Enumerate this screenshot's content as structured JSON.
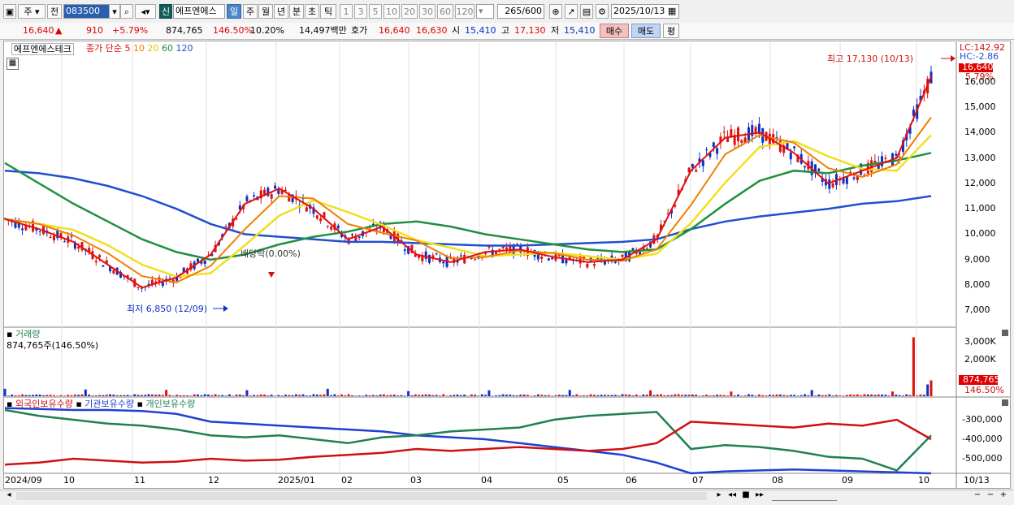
{
  "toolbar": {
    "period_label": "주",
    "prev_label": "전",
    "code_value": "083500",
    "new_badge": "신",
    "stock_name": "에프엔에스",
    "periods": [
      "일",
      "주",
      "월",
      "년",
      "분",
      "초",
      "틱"
    ],
    "active_period": "일",
    "intervals": [
      "1",
      "3",
      "5",
      "10",
      "20",
      "30",
      "60",
      "120"
    ],
    "count_value": "265",
    "count_total": "/600",
    "date_value": "2025/10/13"
  },
  "quote": {
    "price": "16,640",
    "up_arrow": "▲",
    "change": "910",
    "change_pct": "+5.79%",
    "volume": "874,765",
    "volume_ratio": "146.50%",
    "turnover_pct": "10.20%",
    "amount": "14,497백만",
    "hoga_label": "호가",
    "ask": "16,640",
    "bid": "16,630",
    "open_label": "시",
    "open": "15,410",
    "high_label": "고",
    "high": "17,130",
    "low_label": "저",
    "low": "15,410",
    "buy_label": "매수",
    "sell_label": "매도",
    "eval_label": "평"
  },
  "price_panel": {
    "name_tag": "에프엔에스테크",
    "ma_label": "종가 단순",
    "ma_periods": [
      "5",
      "10",
      "20",
      "60",
      "120"
    ],
    "ma_colors": [
      "#e01010",
      "#f08000",
      "#f0e020",
      "#209040",
      "#2050d0"
    ],
    "lc_label": "LC:142.92",
    "hc_label": "HC:-2.86",
    "current_price_tag": "16,640",
    "current_pct_tag": "5.79%",
    "high_annotation": "최고 17,130 (10/13)",
    "low_annotation": "최저 6,850 (12/09)",
    "dividend_annotation": "배당락(0.00%)",
    "y_ticks": [
      "16,000",
      "15,000",
      "14,000",
      "13,000",
      "12,000",
      "11,000",
      "10,000",
      "9,000",
      "8,000",
      "7,000"
    ]
  },
  "volume_panel": {
    "title": "거래량",
    "value_label": "874,765주(146.50%)",
    "y_ticks": [
      "3,000K",
      "2,000K"
    ],
    "current_tag": "874,765",
    "current_pct_tag": "146.50%"
  },
  "holdings_panel": {
    "legends": [
      "외국인보유수량",
      "기관보유수량",
      "개인보유수량"
    ],
    "legend_colors": [
      "#d01010",
      "#2040d0",
      "#208050"
    ],
    "y_ticks": [
      "-300,000",
      "-400,000",
      "-500,000"
    ]
  },
  "x_axis": {
    "labels": [
      "2024/09",
      "10",
      "11",
      "12",
      "2025/01",
      "02",
      "03",
      "04",
      "05",
      "06",
      "07",
      "08",
      "09",
      "10"
    ],
    "last_date": "10/13"
  },
  "chart_data": {
    "type": "line",
    "title": "에프엔에스테크",
    "series": [
      {
        "name": "종가 단순 5",
        "values": [
          10600,
          10200,
          9700,
          8800,
          7900,
          8300,
          9200,
          11200,
          11800,
          11000,
          9800,
          10300,
          9200,
          8900,
          9300,
          9400,
          9100,
          8900,
          9000,
          9800,
          12500,
          13800,
          14000,
          13200,
          12000,
          12500,
          13000,
          16200
        ]
      },
      {
        "name": "종가 단순 60",
        "values": [
          12800,
          12000,
          11200,
          10500,
          9800,
          9300,
          9000,
          9200,
          9600,
          9900,
          10100,
          10400,
          10500,
          10300,
          10000,
          9800,
          9600,
          9400,
          9300,
          9400,
          10200,
          11200,
          12100,
          12500,
          12400,
          12700,
          12900,
          13200
        ]
      },
      {
        "name": "종가 단순 120",
        "values": [
          12500,
          12400,
          12200,
          11900,
          11500,
          11000,
          10400,
          10000,
          9900,
          9800,
          9700,
          9700,
          9650,
          9600,
          9550,
          9550,
          9600,
          9650,
          9700,
          9800,
          10200,
          10500,
          10700,
          10850,
          11000,
          11200,
          11300,
          11500
        ]
      }
    ],
    "ylim": [
      6500,
      17300
    ]
  }
}
